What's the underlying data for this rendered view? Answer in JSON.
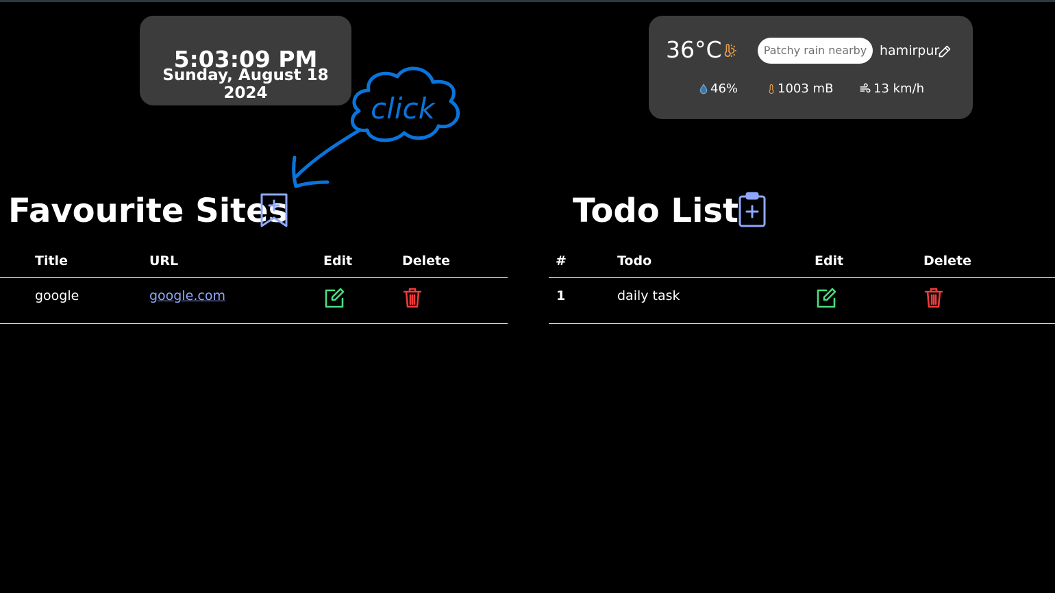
{
  "clock": {
    "time": "5:03:09 PM",
    "date": "Sunday, August 18 2024"
  },
  "weather": {
    "temperature": "36°C",
    "condition": "Patchy rain nearby",
    "city": "hamirpur",
    "humidity": "46%",
    "pressure": "1003 mB",
    "wind": "13 km/h",
    "icons": [
      "thermometer-sun-icon",
      "pencil-icon",
      "droplet-icon",
      "thermometer-icon",
      "wind-icon"
    ]
  },
  "favourites": {
    "title": "Favourite Sites",
    "add_icon": "bookmark-plus-icon",
    "columns": [
      "Title",
      "URL",
      "Edit",
      "Delete"
    ],
    "rows": [
      {
        "title": "google",
        "url": "google.com"
      }
    ]
  },
  "todos": {
    "title": "Todo List",
    "add_icon": "clipboard-plus-icon",
    "columns": [
      "#",
      "Todo",
      "Edit",
      "Delete"
    ],
    "rows": [
      {
        "num": "1",
        "todo": "daily task"
      }
    ]
  },
  "annotation": {
    "text": "click"
  },
  "colors": {
    "background": "#000000",
    "card": "#3c3c3c",
    "accent_blue": "#8ea8ff",
    "edit_green": "#4ade80",
    "delete_red": "#ef3b3b",
    "annotation_blue": "#0a74da",
    "humidity_blue": "#5aa9e6",
    "thermo_orange": "#e9a04a"
  }
}
